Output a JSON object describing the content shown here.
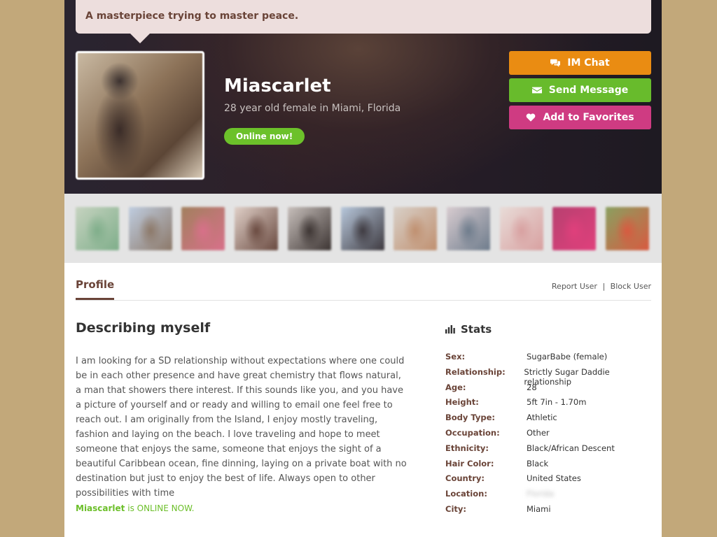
{
  "header": {
    "tagline": "A masterpiece trying to master peace.",
    "name": "Miascarlet",
    "subtitle": "28 year old female in Miami, Florida",
    "status_pill": "Online now!"
  },
  "actions": {
    "chat_label": "IM Chat",
    "message_label": "Send Message",
    "favorite_label": "Add to Favorites"
  },
  "colors": {
    "chat": "#ea8c12",
    "message": "#68bb2c",
    "favorite": "#cf3b82",
    "online": "#6cc12a",
    "brand_brown": "#6a4438"
  },
  "thumbnails": [
    {
      "color_a": "#7fae8a",
      "color_b": "#c6d3c0"
    },
    {
      "color_a": "#8c7868",
      "color_b": "#bfcde0"
    },
    {
      "color_a": "#d8708a",
      "color_b": "#a2805e"
    },
    {
      "color_a": "#6a4a40",
      "color_b": "#e0d0c8"
    },
    {
      "color_a": "#3c3432",
      "color_b": "#c8c0bc"
    },
    {
      "color_a": "#3e3a40",
      "color_b": "#b8c8dc"
    },
    {
      "color_a": "#c09070",
      "color_b": "#d8d0c8"
    },
    {
      "color_a": "#6e7c8c",
      "color_b": "#d8ccd0"
    },
    {
      "color_a": "#d8a0a0",
      "color_b": "#e8dcd8"
    },
    {
      "color_a": "#e0407c",
      "color_b": "#b84070"
    },
    {
      "color_a": "#d85a40",
      "color_b": "#8aa060"
    }
  ],
  "profile": {
    "tab_label": "Profile",
    "report_link": "Report User",
    "block_link": "Block User",
    "separator": "|",
    "describe_title": "Describing myself",
    "describe_text": "I am looking for a SD relationship without expectations where one could be in each other presence and have great chemistry that flows natural, a man that showers there interest. If this sounds like you, and you have a picture of yourself and or ready and willing to email one feel free to reach out. I am originally from the Island, I enjoy mostly traveling, fashion and laying on the beach. I love traveling and hope to meet someone that enjoys the same, someone that enjoys the sight of a beautiful Caribbean ocean, fine dinning, laying on a private boat with no destination but just to enjoy the best of life. Always open to other possibilities with time",
    "online_name": "Miascarlet",
    "online_suffix": " is ONLINE NOW."
  },
  "stats": {
    "title": "Stats",
    "rows": [
      {
        "key": "Sex:",
        "value": "SugarBabe (female)"
      },
      {
        "key": "Relationship:",
        "value": "Strictly Sugar Daddie relationship"
      },
      {
        "key": "Age:",
        "value": "28"
      },
      {
        "key": "Height:",
        "value": "5ft 7in - 1.70m"
      },
      {
        "key": "Body Type:",
        "value": "Athletic"
      },
      {
        "key": "Occupation:",
        "value": "Other"
      },
      {
        "key": "Ethnicity:",
        "value": "Black/African Descent"
      },
      {
        "key": "Hair Color:",
        "value": "Black"
      },
      {
        "key": "Country:",
        "value": "United States"
      },
      {
        "key": "Location:",
        "value": "Florida"
      },
      {
        "key": "City:",
        "value": "Miami"
      }
    ]
  }
}
